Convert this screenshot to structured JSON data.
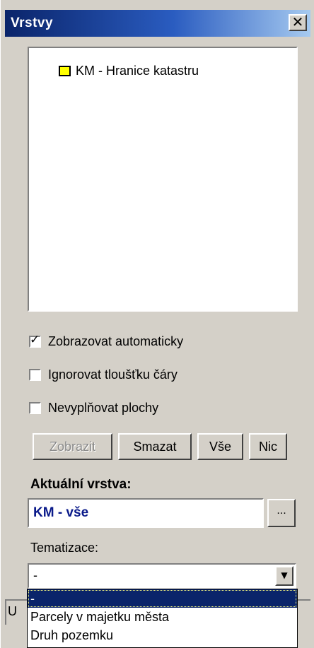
{
  "window": {
    "title": "Vrstvy",
    "close_glyph": "✕"
  },
  "tree": {
    "items": [
      {
        "label": "KM - Hranice katastru",
        "icon": "layer-icon",
        "icon_color": "#ffff00"
      }
    ]
  },
  "options": {
    "auto_display": {
      "label": "Zobrazovat automaticky",
      "checked": true
    },
    "ignore_line_width": {
      "label": "Ignorovat tloušťku čáry",
      "checked": false
    },
    "no_fill": {
      "label": "Nevyplňovat plochy",
      "checked": false
    }
  },
  "buttons": {
    "show": "Zobrazit",
    "delete": "Smazat",
    "all": "Vše",
    "none": "Nic"
  },
  "current_layer": {
    "label": "Aktuální vrstva:",
    "value": "KM - vše",
    "browse": "..."
  },
  "thematization": {
    "label": "Tematizace:",
    "selected": "-",
    "options": [
      "-",
      "Parcely v majetku města",
      "Druh pozemku"
    ]
  },
  "status_strip": {
    "text": "U"
  },
  "colors": {
    "title_gradient_start": "#0a246a",
    "title_gradient_end": "#a6caf0",
    "current_layer_text": "#0a1a8a",
    "selection": "#0a246a",
    "window_bg": "#d4d0c8"
  }
}
